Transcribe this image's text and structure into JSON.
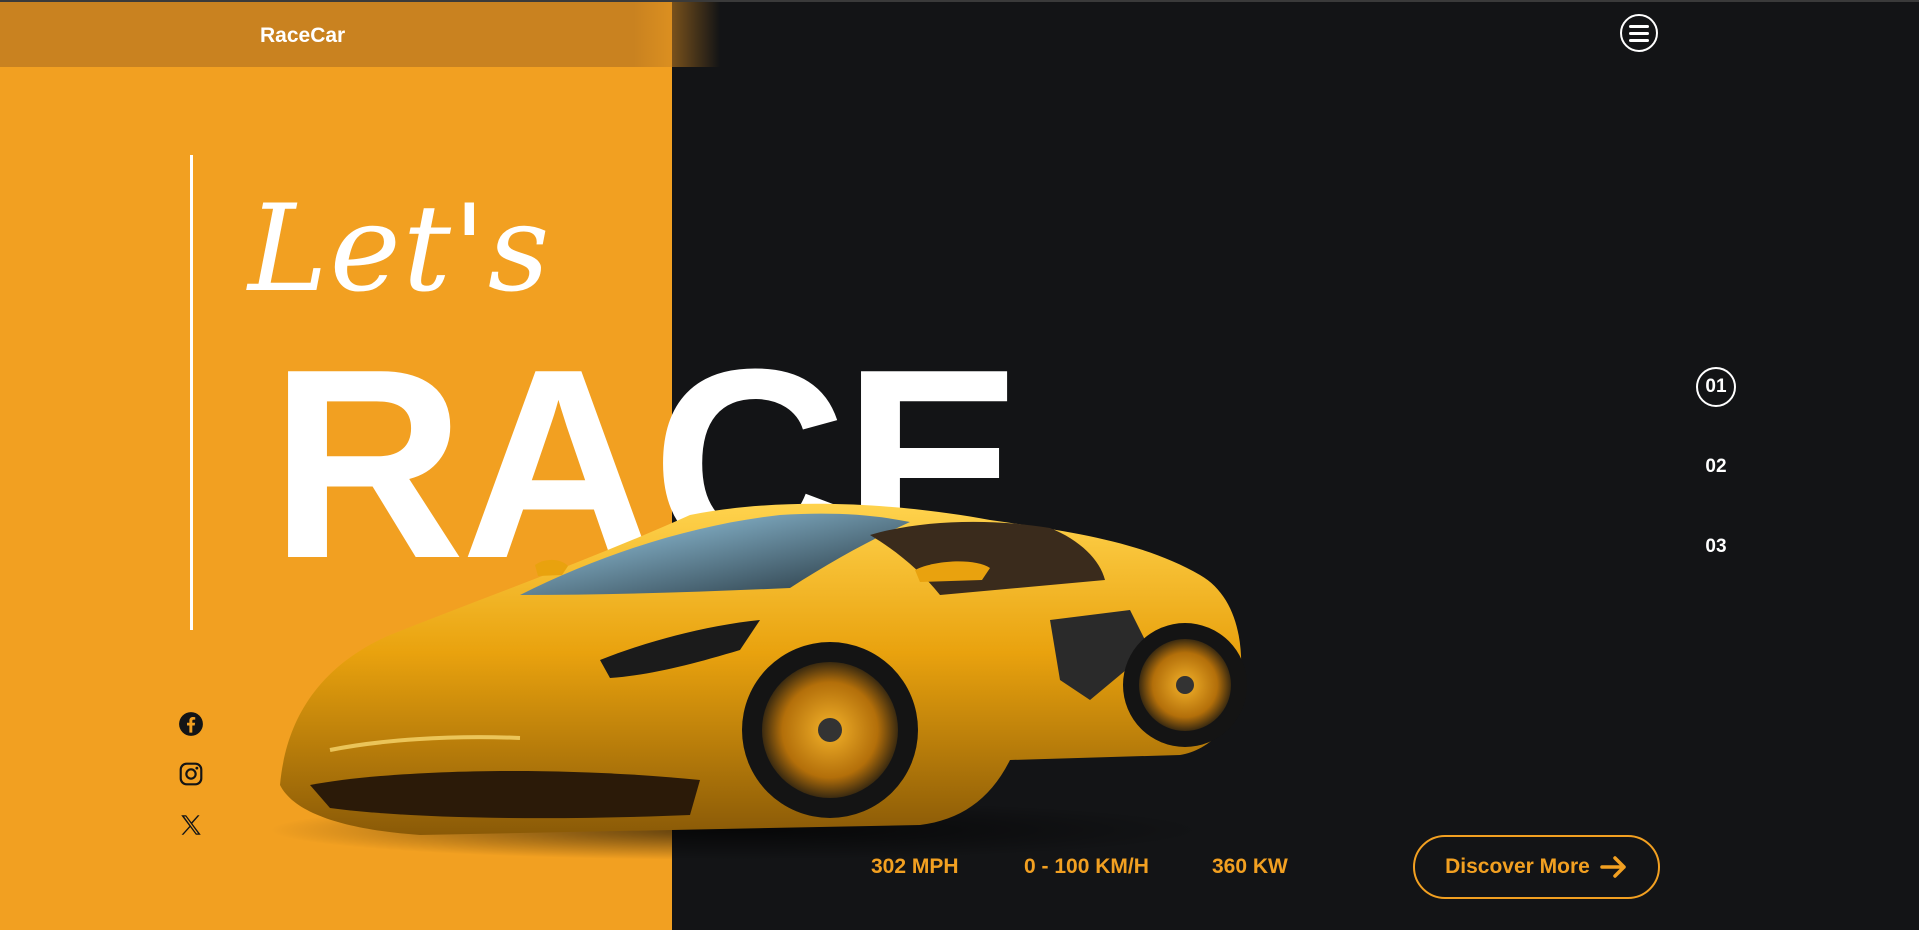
{
  "brand": "RaceCar",
  "hero": {
    "script_text": "Let's",
    "big_text": "RACE"
  },
  "stats": [
    "302 MPH",
    "0 - 100 KM/H",
    "360 KW"
  ],
  "cta": {
    "label": "Discover More"
  },
  "slides": [
    "01",
    "02",
    "03"
  ],
  "active_slide": "01",
  "social_icons": [
    "facebook-icon",
    "instagram-icon",
    "x-icon"
  ],
  "colors": {
    "accent": "#f2a021",
    "dark_bg": "#131416",
    "nav_bg": "#c98220",
    "text": "#ffffff"
  }
}
